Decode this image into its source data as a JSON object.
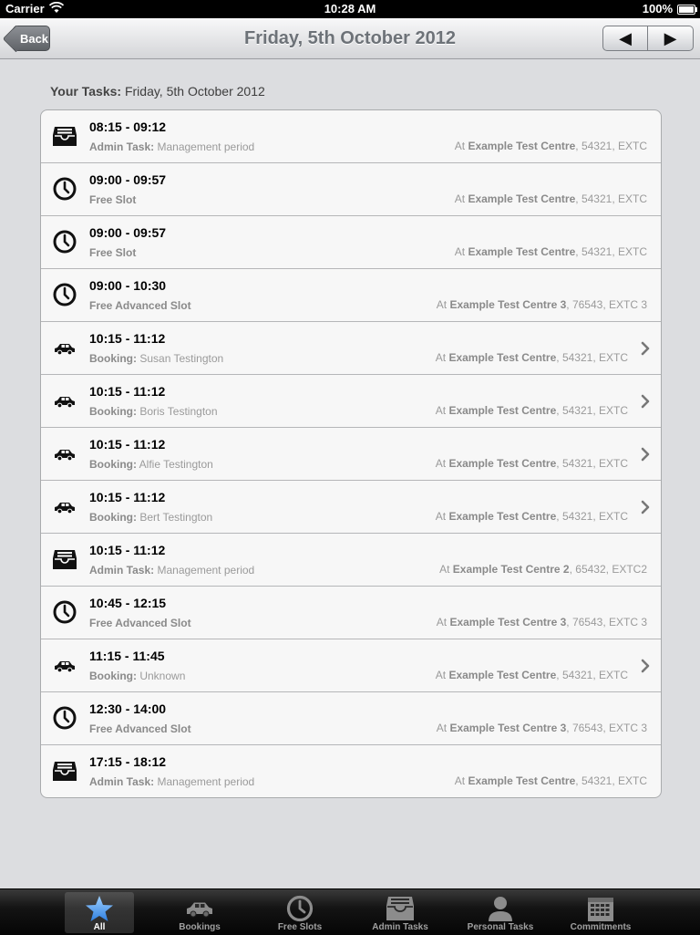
{
  "status_bar": {
    "carrier": "Carrier",
    "time": "10:28 AM",
    "battery": "100%"
  },
  "navbar": {
    "back_label": "Back",
    "title": "Friday, 5th October 2012",
    "prev_symbol": "◀",
    "next_symbol": "▶"
  },
  "section": {
    "label": "Your Tasks:",
    "date": "Friday, 5th October 2012"
  },
  "tasks": [
    {
      "icon": "inbox-icon",
      "time": "08:15 - 09:12",
      "kind": "Admin Task:",
      "detail": "Management period",
      "at": "At",
      "centre": "Example Test Centre",
      "code": ", 54321, EXTC",
      "chevron": false
    },
    {
      "icon": "clock-icon",
      "time": "09:00 - 09:57",
      "kind": "Free Slot",
      "detail": "",
      "at": "At",
      "centre": "Example Test Centre",
      "code": ", 54321, EXTC",
      "chevron": false
    },
    {
      "icon": "clock-icon",
      "time": "09:00 - 09:57",
      "kind": "Free Slot",
      "detail": "",
      "at": "At",
      "centre": "Example Test Centre",
      "code": ", 54321, EXTC",
      "chevron": false
    },
    {
      "icon": "clock-icon",
      "time": "09:00 - 10:30",
      "kind": "Free Advanced Slot",
      "detail": "",
      "at": "At",
      "centre": "Example Test Centre 3",
      "code": ", 76543, EXTC 3",
      "chevron": false
    },
    {
      "icon": "car-icon",
      "time": "10:15 - 11:12",
      "kind": "Booking:",
      "detail": "Susan Testington",
      "at": "At",
      "centre": "Example Test Centre",
      "code": ", 54321, EXTC",
      "chevron": true
    },
    {
      "icon": "car-icon",
      "time": "10:15 - 11:12",
      "kind": "Booking:",
      "detail": "Boris Testington",
      "at": "At",
      "centre": "Example Test Centre",
      "code": ", 54321, EXTC",
      "chevron": true
    },
    {
      "icon": "car-icon",
      "time": "10:15 - 11:12",
      "kind": "Booking:",
      "detail": "Alfie Testington",
      "at": "At",
      "centre": "Example Test Centre",
      "code": ", 54321, EXTC",
      "chevron": true
    },
    {
      "icon": "car-icon",
      "time": "10:15 - 11:12",
      "kind": "Booking:",
      "detail": "Bert Testington",
      "at": "At",
      "centre": "Example Test Centre",
      "code": ", 54321, EXTC",
      "chevron": true
    },
    {
      "icon": "inbox-icon",
      "time": "10:15 - 11:12",
      "kind": "Admin Task:",
      "detail": "Management period",
      "at": "At",
      "centre": "Example Test Centre 2",
      "code": ", 65432, EXTC2",
      "chevron": false
    },
    {
      "icon": "clock-icon",
      "time": "10:45 - 12:15",
      "kind": "Free Advanced Slot",
      "detail": "",
      "at": "At",
      "centre": "Example Test Centre 3",
      "code": ", 76543, EXTC 3",
      "chevron": false
    },
    {
      "icon": "car-icon",
      "time": "11:15 - 11:45",
      "kind": "Booking:",
      "detail": "Unknown",
      "at": "At",
      "centre": "Example Test Centre",
      "code": ", 54321, EXTC",
      "chevron": true
    },
    {
      "icon": "clock-icon",
      "time": "12:30 - 14:00",
      "kind": "Free Advanced Slot",
      "detail": "",
      "at": "At",
      "centre": "Example Test Centre 3",
      "code": ", 76543, EXTC 3",
      "chevron": false
    },
    {
      "icon": "inbox-icon",
      "time": "17:15 - 18:12",
      "kind": "Admin Task:",
      "detail": "Management period",
      "at": "At",
      "centre": "Example Test Centre",
      "code": ", 54321, EXTC",
      "chevron": false
    }
  ],
  "tabbar": [
    {
      "label": "All",
      "icon": "star-icon",
      "active": true
    },
    {
      "label": "Bookings",
      "icon": "car-icon",
      "active": false
    },
    {
      "label": "Free Slots",
      "icon": "clock-icon",
      "active": false
    },
    {
      "label": "Admin Tasks",
      "icon": "inbox-icon",
      "active": false
    },
    {
      "label": "Personal Tasks",
      "icon": "person-icon",
      "active": false
    },
    {
      "label": "Commitments",
      "icon": "calendar-icon",
      "active": false
    }
  ],
  "colors": {
    "tab_active_star": "#3b8fe8",
    "navbar_title": "#6d7278"
  }
}
